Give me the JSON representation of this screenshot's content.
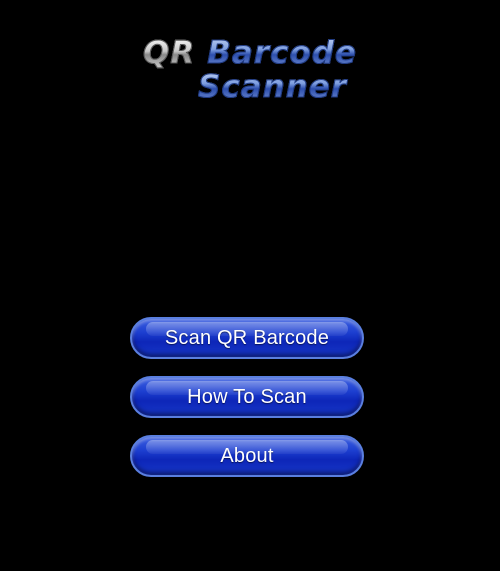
{
  "logo": {
    "qr": "QR",
    "barcode": "Barcode",
    "scanner": "Scanner"
  },
  "menu": {
    "scan_label": "Scan QR Barcode",
    "how_to_label": "How To Scan",
    "about_label": "About"
  },
  "colors": {
    "background": "#000000",
    "button_blue": "#1d3fd0",
    "button_border": "#5a7fe0",
    "logo_blue": "#6f8fd6",
    "logo_silver": "#d6d6d6"
  }
}
